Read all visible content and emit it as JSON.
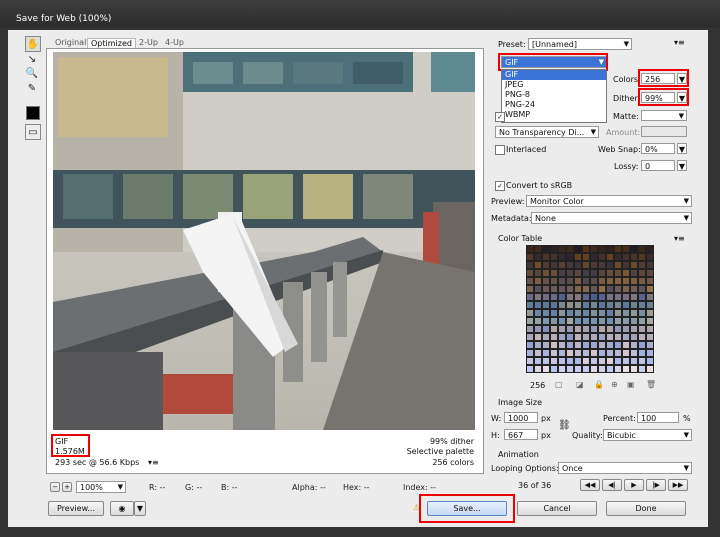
{
  "window": {
    "title": "Save for Web (100%)"
  },
  "tabs": [
    {
      "label": "Original"
    },
    {
      "label": "Optimized"
    },
    {
      "label": "2-Up"
    },
    {
      "label": "4-Up"
    }
  ],
  "image_info": {
    "format": "GIF",
    "size": "1.576M",
    "time": "293 sec @ 56.6 Kbps",
    "dither": "99% dither",
    "palette": "Selective palette",
    "colors": "256 colors"
  },
  "settings": {
    "preset_label": "Preset:",
    "preset_value": "[Unnamed]",
    "format_value": "GIF",
    "format_options": [
      "GIF",
      "JPEG",
      "PNG-8",
      "PNG-24",
      "WBMP"
    ],
    "colors_label": "Colors:",
    "colors_value": "256",
    "dither_label": "Dither:",
    "dither_value": "99%",
    "matte_label": "Matte:",
    "transparency_value": "No Transparency Di...",
    "amount_label": "Amount:",
    "interlaced_label": "Interlaced",
    "websnap_label": "Web Snap:",
    "websnap_value": "0%",
    "lossy_label": "Lossy:",
    "lossy_value": "0",
    "convert_label": "Convert to sRGB",
    "preview_label": "Preview:",
    "preview_value": "Monitor Color",
    "metadata_label": "Metadata:",
    "metadata_value": "None"
  },
  "color_table": {
    "title": "Color Table",
    "count": "256"
  },
  "image_size": {
    "title": "Image Size",
    "w_label": "W:",
    "w_value": "1000",
    "h_label": "H:",
    "h_value": "667",
    "px": "px",
    "percent_label": "Percent:",
    "percent_value": "100",
    "percent_unit": "%",
    "quality_label": "Quality:",
    "quality_value": "Bicubic"
  },
  "animation": {
    "title": "Animation",
    "looping_label": "Looping Options:",
    "looping_value": "Once",
    "frame_text": "36 of 36"
  },
  "statusbar": {
    "zoom": "100%",
    "r": "R: --",
    "g": "G: --",
    "b": "B: --",
    "alpha": "Alpha: --",
    "hex": "Hex: --",
    "index": "Index: --"
  },
  "buttons": {
    "preview": "Preview...",
    "save": "Save...",
    "cancel": "Cancel",
    "done": "Done"
  }
}
